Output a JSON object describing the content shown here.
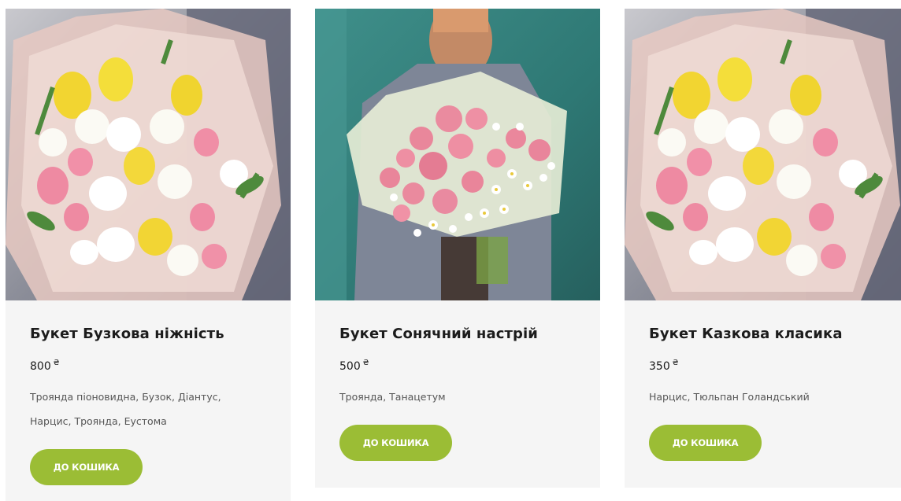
{
  "products": [
    {
      "title": "Букет Бузкова ніжність",
      "price": "800",
      "currency": "₴",
      "ingredients": "Троянда піоновидна, Бузок, Діантус, Нарцис, Троянда, Еустома",
      "button_label": "ДО КОШИКА"
    },
    {
      "title": "Букет Сонячний настрій",
      "price": "500",
      "currency": "₴",
      "ingredients": "Троянда, Танацетум",
      "button_label": "ДО КОШИКА"
    },
    {
      "title": "Букет Казкова класика",
      "price": "350",
      "currency": "₴",
      "ingredients": "Нарцис, Тюльпан Голандський",
      "button_label": "ДО КОШИКА"
    }
  ],
  "colors": {
    "card_bg": "#f5f5f5",
    "button_bg": "#9bbd35",
    "button_text": "#ffffff",
    "title_text": "#1c1c1c",
    "desc_text": "#555555"
  }
}
